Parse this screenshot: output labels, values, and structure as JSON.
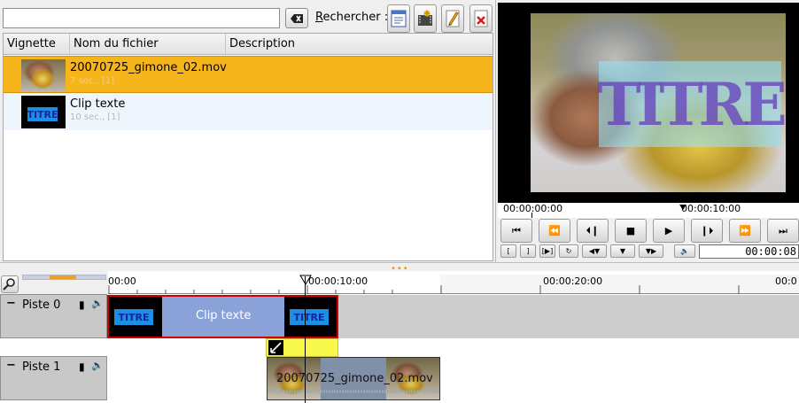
{
  "search": {
    "value": "",
    "label_prefix": "R",
    "label_rest": "echercher :"
  },
  "toolbar": {
    "buttons": [
      "properties-icon",
      "add-clip-icon",
      "edit-icon",
      "delete-icon"
    ]
  },
  "clip_list": {
    "columns": [
      "Vignette",
      "Nom du fichier",
      "Description"
    ],
    "rows": [
      {
        "name": "20070725_gimone_02.mov",
        "info": "7 sec., [1]",
        "selected": true
      },
      {
        "name": "Clip texte",
        "info": "10 sec., [1]",
        "selected": false
      }
    ]
  },
  "monitor": {
    "overlay_text": "TITRE",
    "ruler_start": "00:00:00:00",
    "ruler_mark": "00:00:10:00",
    "timecode": "00:00:08"
  },
  "timeline": {
    "ruler_labels": [
      "00:00",
      "00:00:10:00",
      "00:00:20:00",
      "00:0"
    ],
    "tracks": [
      {
        "name": "Piste 0",
        "clip_label": "Clip texte",
        "thumb_text": "TITRE"
      },
      {
        "name": "Piste 1",
        "clip_label": "20070725_gimone_02.mov"
      }
    ]
  },
  "colors": {
    "selection": "#f5b51b",
    "clip_titre": "#8aa2d7",
    "transition": "#f8f84a"
  }
}
